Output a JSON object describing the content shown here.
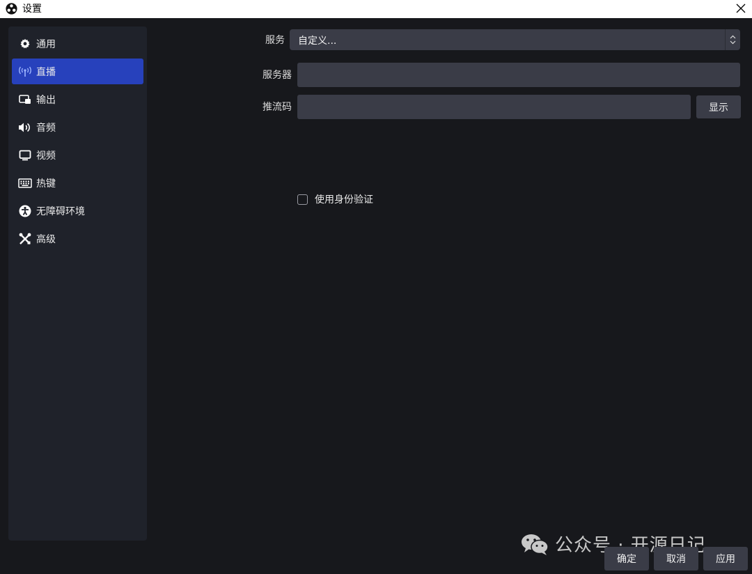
{
  "window": {
    "title": "设置",
    "app_icon": "obs-logo-icon",
    "close_icon": "close-icon"
  },
  "sidebar": {
    "items": [
      {
        "label": "通用",
        "icon": "gear-icon",
        "active": false
      },
      {
        "label": "直播",
        "icon": "broadcast-antenna-icon",
        "active": true
      },
      {
        "label": "输出",
        "icon": "output-monitor-icon",
        "active": false
      },
      {
        "label": "音频",
        "icon": "speaker-icon",
        "active": false
      },
      {
        "label": "视频",
        "icon": "display-icon",
        "active": false
      },
      {
        "label": "热键",
        "icon": "keyboard-icon",
        "active": false
      },
      {
        "label": "无障碍环境",
        "icon": "accessibility-icon",
        "active": false
      },
      {
        "label": "高级",
        "icon": "tools-icon",
        "active": false
      }
    ]
  },
  "stream": {
    "service_label": "服务",
    "service_value": "自定义...",
    "server_label": "服务器",
    "server_value": "",
    "key_label": "推流码",
    "key_value": "",
    "show_button": "显示",
    "auth_checkbox_label": "使用身份验证",
    "auth_checked": false
  },
  "footer": {
    "ok": "确定",
    "cancel": "取消",
    "apply": "应用"
  },
  "watermark": {
    "text": "公众号 · 开源日记",
    "icon": "wechat-icon"
  },
  "colors": {
    "background": "#17181c",
    "sidebar": "#1f222a",
    "active_item": "#2741bc",
    "control": "#3a3c47"
  }
}
